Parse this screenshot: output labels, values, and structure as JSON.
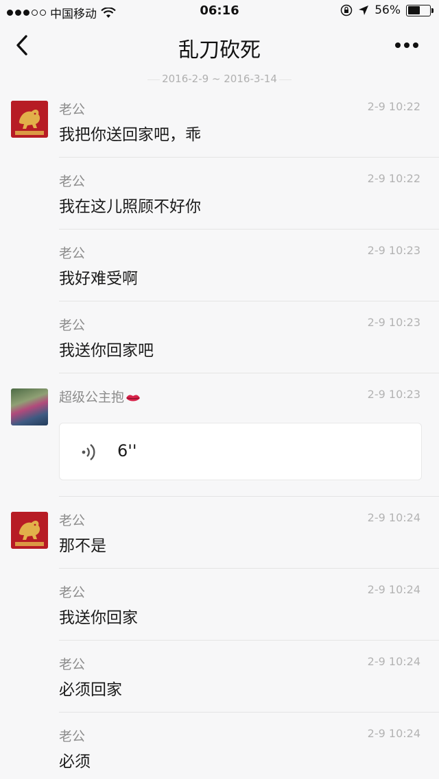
{
  "status_bar": {
    "carrier": "中国移动",
    "time": "06:16",
    "battery_percent": "56%",
    "battery_level": 0.56,
    "signal_bars": 3,
    "signal_total": 5
  },
  "nav": {
    "title": "乱刀砍死",
    "back_icon": "chevron-left-icon",
    "more_icon": "more-dots-icon"
  },
  "date_range": "2016-2-9 ~ 2016-3-14",
  "messages": [
    {
      "sender": "老公",
      "time": "2-9 10:22",
      "text": "我把你送回家吧，乖",
      "avatar": "brand-tiger"
    },
    {
      "sender": "老公",
      "time": "2-9 10:22",
      "text": "我在这儿照顾不好你",
      "avatar": ""
    },
    {
      "sender": "老公",
      "time": "2-9 10:23",
      "text": "我好难受啊",
      "avatar": ""
    },
    {
      "sender": "老公",
      "time": "2-9 10:23",
      "text": "我送你回家吧",
      "avatar": ""
    },
    {
      "sender": "超级公主抱",
      "time": "2-9 10:23",
      "type": "voice",
      "duration": "6''",
      "avatar": "photo",
      "sender_emoji": "lips-icon"
    },
    {
      "sender": "老公",
      "time": "2-9 10:24",
      "text": "那不是",
      "avatar": "brand-tiger"
    },
    {
      "sender": "老公",
      "time": "2-9 10:24",
      "text": "我送你回家",
      "avatar": ""
    },
    {
      "sender": "老公",
      "time": "2-9 10:24",
      "text": "必须回家",
      "avatar": ""
    },
    {
      "sender": "老公",
      "time": "2-9 10:24",
      "text": "必须",
      "avatar": ""
    }
  ],
  "colors": {
    "background": "#f7f7f8",
    "brand_avatar": "#b71c25",
    "divider": "#e4e4e4",
    "meta_text": "#b3b3b3"
  }
}
